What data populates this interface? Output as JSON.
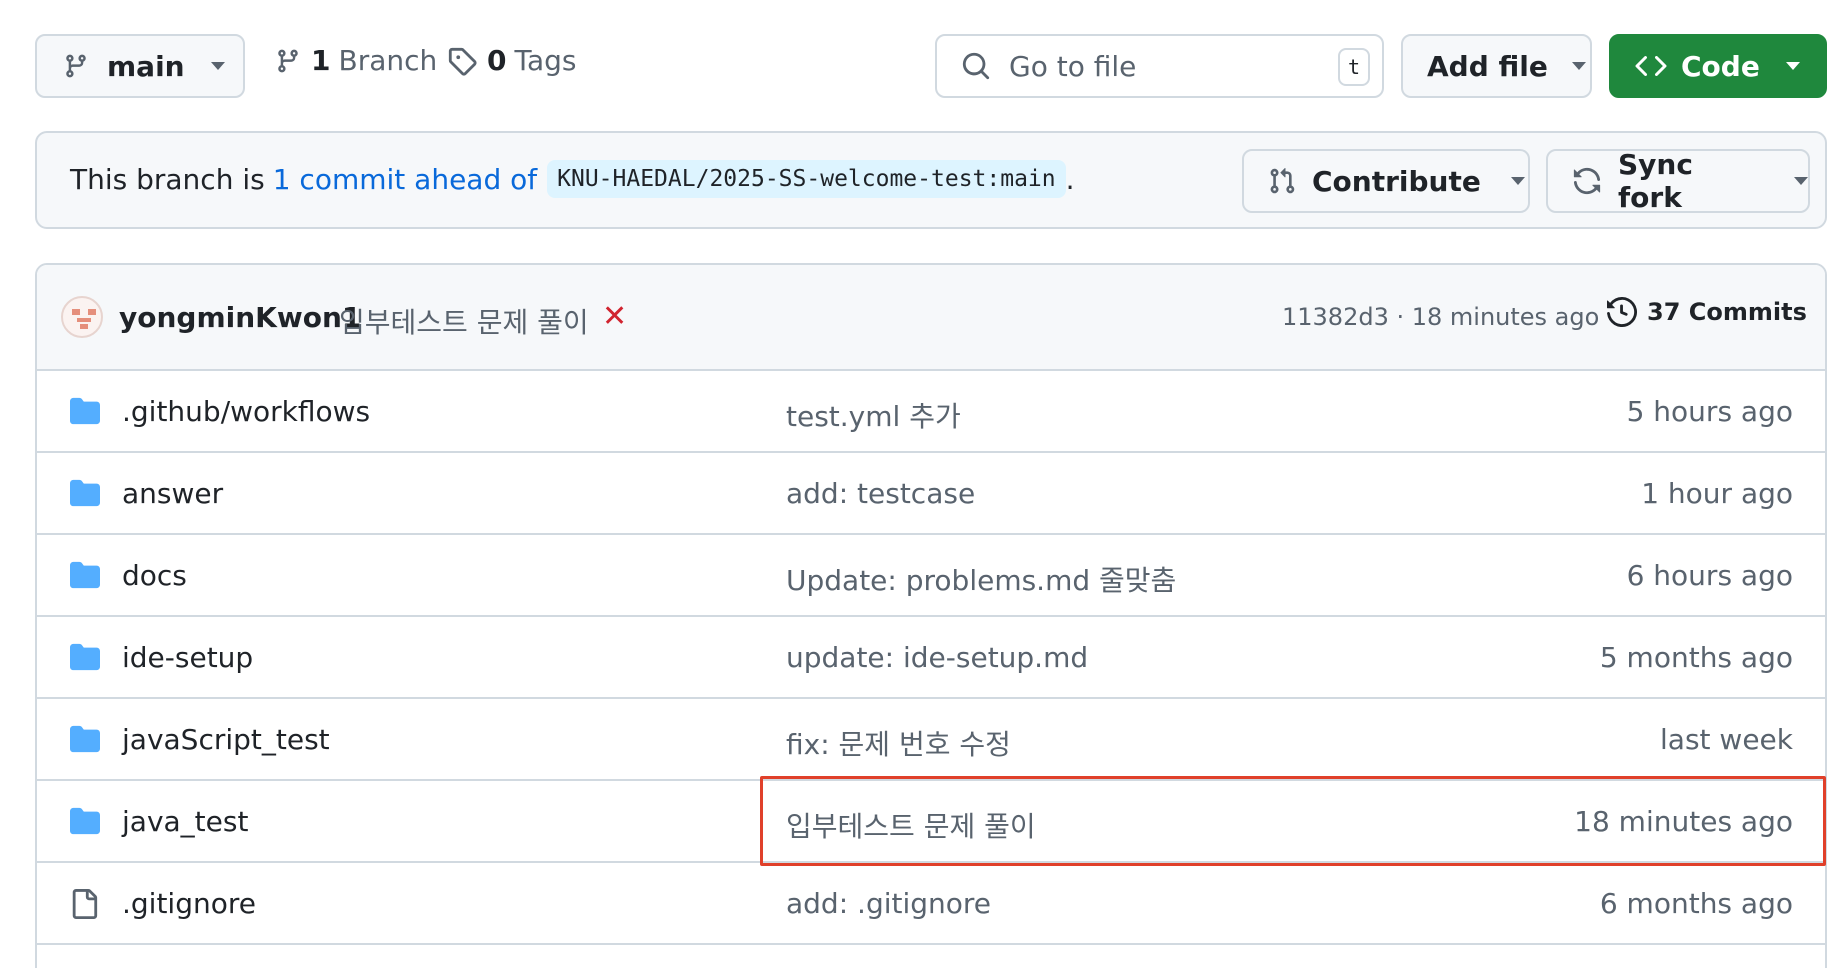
{
  "topbar": {
    "branch": "main",
    "branches_count": "1",
    "branches_label": "Branch",
    "tags_count": "0",
    "tags_label": "Tags",
    "search_placeholder": "Go to file",
    "search_shortcut": "t",
    "add_file_label": "Add file",
    "code_label": "Code"
  },
  "fork_banner": {
    "prefix": "This branch is",
    "link": "1 commit ahead of",
    "upstream": "KNU-HAEDAL/2025-SS-welcome-test:main",
    "suffix": ".",
    "contribute_label": "Contribute",
    "sync_label": "Sync fork"
  },
  "latest_commit": {
    "author": "yongminKwon1",
    "message": "입부테스트 문제 풀이",
    "status": "✕",
    "sha_time": "11382d3 · 18 minutes ago",
    "commits_label": "37 Commits"
  },
  "files": [
    {
      "name": ".github/workflows",
      "type": "folder",
      "message": "test.yml 추가",
      "date": "5 hours ago"
    },
    {
      "name": "answer",
      "type": "folder",
      "message": "add: testcase",
      "date": "1 hour ago"
    },
    {
      "name": "docs",
      "type": "folder",
      "message": "Update: problems.md 줄맞춤",
      "date": "6 hours ago"
    },
    {
      "name": "ide-setup",
      "type": "folder",
      "message": "update: ide-setup.md",
      "date": "5 months ago"
    },
    {
      "name": "javaScript_test",
      "type": "folder",
      "message": "fix: 문제 번호 수정",
      "date": "last week"
    },
    {
      "name": "java_test",
      "type": "folder",
      "message": "입부테스트 문제 풀이",
      "date": "18 minutes ago"
    },
    {
      "name": ".gitignore",
      "type": "file",
      "message": "add: .gitignore",
      "date": "6 months ago"
    }
  ],
  "colors": {
    "accent_green": "#1f883d",
    "link_blue": "#0969da",
    "folder_blue": "#54aeff",
    "highlight_red": "#e0402a",
    "fail_red": "#d1242f"
  },
  "icons": {
    "branch": "git-branch-icon",
    "tag": "tag-icon",
    "search": "search-icon",
    "code": "code-icon",
    "contribute": "git-pull-request-icon",
    "sync": "sync-icon",
    "history": "history-icon",
    "folder": "folder-icon",
    "file": "file-icon"
  }
}
